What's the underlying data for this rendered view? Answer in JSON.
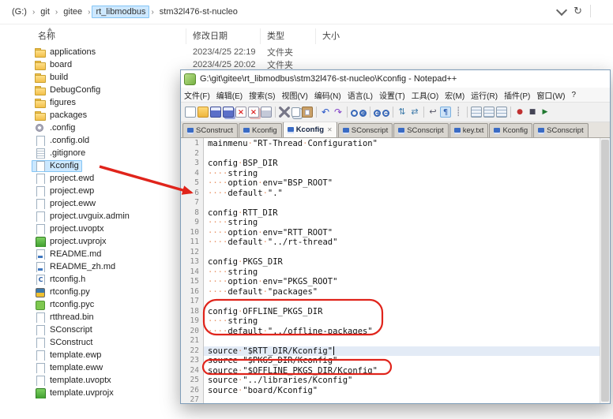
{
  "explorer": {
    "breadcrumb": {
      "items": [
        "(G:)",
        "git",
        "gitee",
        "rt_libmodbus",
        "stm32l476-st-nucleo"
      ],
      "separator": "›",
      "highlighted": "rt_libmodbus"
    },
    "controls": {
      "refresh_glyph": "↻"
    },
    "columns": [
      {
        "label": "名称"
      },
      {
        "label": "修改日期"
      },
      {
        "label": "类型"
      },
      {
        "label": "大小"
      }
    ],
    "files": [
      {
        "name": "applications",
        "icon": "folder",
        "date": "2023/4/25 22:19",
        "type": "文件夹"
      },
      {
        "name": "board",
        "icon": "folder",
        "date": "2023/4/25 20:02",
        "type": "文件夹"
      },
      {
        "name": "build",
        "icon": "folder"
      },
      {
        "name": "DebugConfig",
        "icon": "folder"
      },
      {
        "name": "figures",
        "icon": "folder"
      },
      {
        "name": "packages",
        "icon": "folder"
      },
      {
        "name": ".config",
        "icon": "gear"
      },
      {
        "name": ".config.old",
        "icon": "file"
      },
      {
        "name": ".gitignore",
        "icon": "text"
      },
      {
        "name": "Kconfig",
        "icon": "file",
        "selected": true
      },
      {
        "name": "project.ewd",
        "icon": "file"
      },
      {
        "name": "project.ewp",
        "icon": "file"
      },
      {
        "name": "project.eww",
        "icon": "file"
      },
      {
        "name": "project.uvguix.admin",
        "icon": "file"
      },
      {
        "name": "project.uvoptx",
        "icon": "file"
      },
      {
        "name": "project.uvprojx",
        "icon": "keil"
      },
      {
        "name": "README.md",
        "icon": "md"
      },
      {
        "name": "README_zh.md",
        "icon": "md"
      },
      {
        "name": "rtconfig.h",
        "icon": "c"
      },
      {
        "name": "rtconfig.py",
        "icon": "py"
      },
      {
        "name": "rtconfig.pyc",
        "icon": "pyc"
      },
      {
        "name": "rtthread.bin",
        "icon": "bin"
      },
      {
        "name": "SConscript",
        "icon": "file"
      },
      {
        "name": "SConstruct",
        "icon": "file"
      },
      {
        "name": "template.ewp",
        "icon": "file"
      },
      {
        "name": "template.eww",
        "icon": "file"
      },
      {
        "name": "template.uvoptx",
        "icon": "file"
      },
      {
        "name": "template.uvprojx",
        "icon": "keil"
      }
    ]
  },
  "notepad": {
    "title": "G:\\git\\gitee\\rt_libmodbus\\stm32l476-st-nucleo\\Kconfig - Notepad++",
    "menus": [
      "文件(F)",
      "编辑(E)",
      "搜索(S)",
      "视图(V)",
      "编码(N)",
      "语言(L)",
      "设置(T)",
      "工具(O)",
      "宏(M)",
      "运行(R)",
      "插件(P)",
      "窗口(W)",
      "?"
    ],
    "toolbar": {
      "items": [
        "new",
        "open",
        "save",
        "save-all",
        "close",
        "close-all",
        "print",
        "sep",
        "cut",
        "copy",
        "paste",
        "sep",
        "undo",
        "redo",
        "sep",
        "find",
        "replace",
        "sep",
        "zoom-in",
        "zoom-out",
        "sep",
        "sync-v",
        "sync-h",
        "sep",
        "word-wrap",
        "show-all-chars",
        "indent-guide",
        "sep",
        "function-list",
        "doc-map",
        "doc-list",
        "sep",
        "record-macro",
        "stop-macro",
        "play-macro"
      ],
      "active_item": "show-all-chars"
    },
    "tabs": [
      {
        "label": "SConstruct"
      },
      {
        "label": "Kconfig"
      },
      {
        "label": "Kconfig",
        "active": true
      },
      {
        "label": "SConscript"
      },
      {
        "label": "SConscript"
      },
      {
        "label": "key.txt"
      },
      {
        "label": "Kconfig"
      },
      {
        "label": "SConscript"
      }
    ],
    "editor": {
      "current_line": 22,
      "lines": [
        "mainmenu \"RT-Thread Configuration\"",
        "",
        "config BSP_DIR",
        "    string",
        "    option env=\"BSP_ROOT\"",
        "    default \".\"",
        "",
        "config RTT_DIR",
        "    string",
        "    option env=\"RTT_ROOT\"",
        "    default \"../rt-thread\"",
        "",
        "config PKGS_DIR",
        "    string",
        "    option env=\"PKGS_ROOT\"",
        "    default \"packages\"",
        "",
        "config OFFLINE_PKGS_DIR",
        "    string",
        "    default \"../offline-packages\"",
        "",
        "source \"$RTT_DIR/Kconfig\"",
        "source \"$PKGS_DIR/Kconfig\"",
        "source \"$OFFLINE_PKGS_DIR/Kconfig\"",
        "source \"../libraries/Kconfig\"",
        "source \"board/Kconfig\"",
        ""
      ]
    }
  },
  "annotations": {
    "accent_color": "#e0241b"
  }
}
